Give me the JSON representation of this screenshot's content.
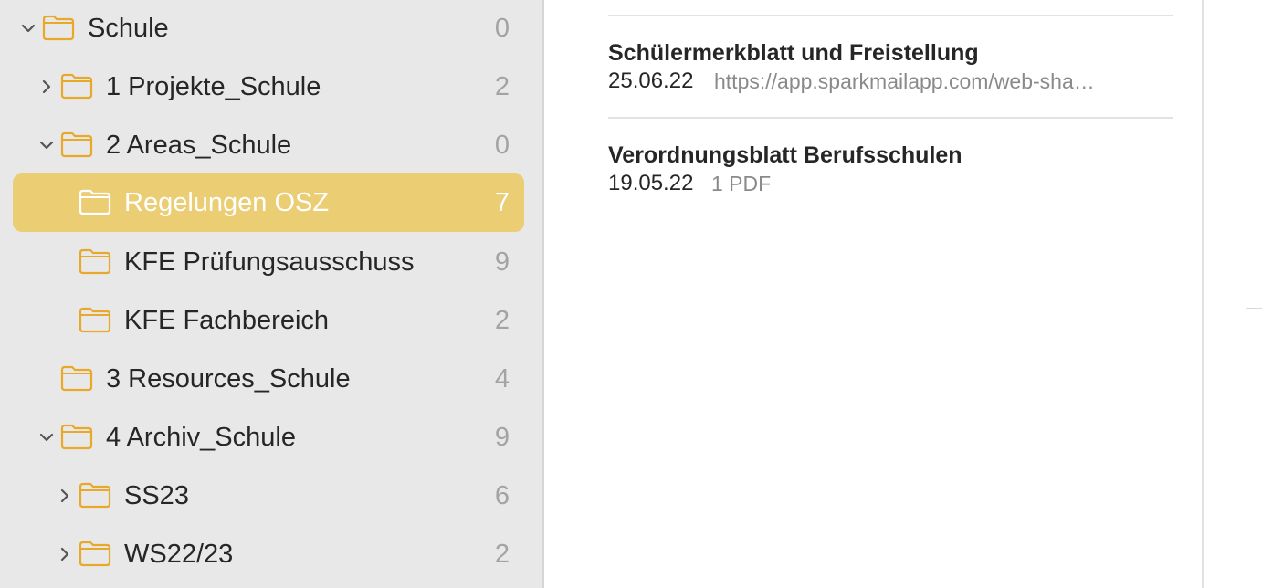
{
  "sidebar": {
    "items": [
      {
        "label": "Schule",
        "count": "0",
        "chevron": "chevron-down-icon",
        "icon": "folder-icon",
        "selected": false
      },
      {
        "label": "1 Projekte_Schule",
        "count": "2",
        "chevron": "chevron-right-icon",
        "icon": "folder-icon",
        "selected": false
      },
      {
        "label": "2 Areas_Schule",
        "count": "0",
        "chevron": "chevron-down-icon",
        "icon": "folder-icon",
        "selected": false
      },
      {
        "label": "Regelungen OSZ",
        "count": "7",
        "chevron": "",
        "icon": "folder-icon",
        "selected": true
      },
      {
        "label": "KFE Prüfungsausschuss",
        "count": "9",
        "chevron": "",
        "icon": "folder-icon",
        "selected": false
      },
      {
        "label": "KFE Fachbereich",
        "count": "2",
        "chevron": "",
        "icon": "folder-icon",
        "selected": false
      },
      {
        "label": "3 Resources_Schule",
        "count": "4",
        "chevron": "",
        "icon": "folder-icon",
        "selected": false
      },
      {
        "label": "4 Archiv_Schule",
        "count": "9",
        "chevron": "chevron-down-icon",
        "icon": "folder-icon",
        "selected": false
      },
      {
        "label": "SS23",
        "count": "6",
        "chevron": "chevron-right-icon",
        "icon": "folder-icon",
        "selected": false
      },
      {
        "label": "WS22/23",
        "count": "2",
        "chevron": "chevron-right-icon",
        "icon": "folder-icon",
        "selected": false
      }
    ]
  },
  "notes": [
    {
      "title": "Schülermerkblatt und Freistellung",
      "date": "25.06.22",
      "snippet": "https://app.sparkmailapp.com/web-sha…"
    },
    {
      "title": "Verordnungsblatt Berufsschulen",
      "date": "19.05.22",
      "snippet": "1 PDF"
    }
  ],
  "colors": {
    "sidebar_bg": "#e8e8e8",
    "selection": "#ebcd74",
    "folder_accent": "#e8a92b",
    "count_text": "#a3a3a3",
    "snippet_text": "#8a8a8a"
  }
}
